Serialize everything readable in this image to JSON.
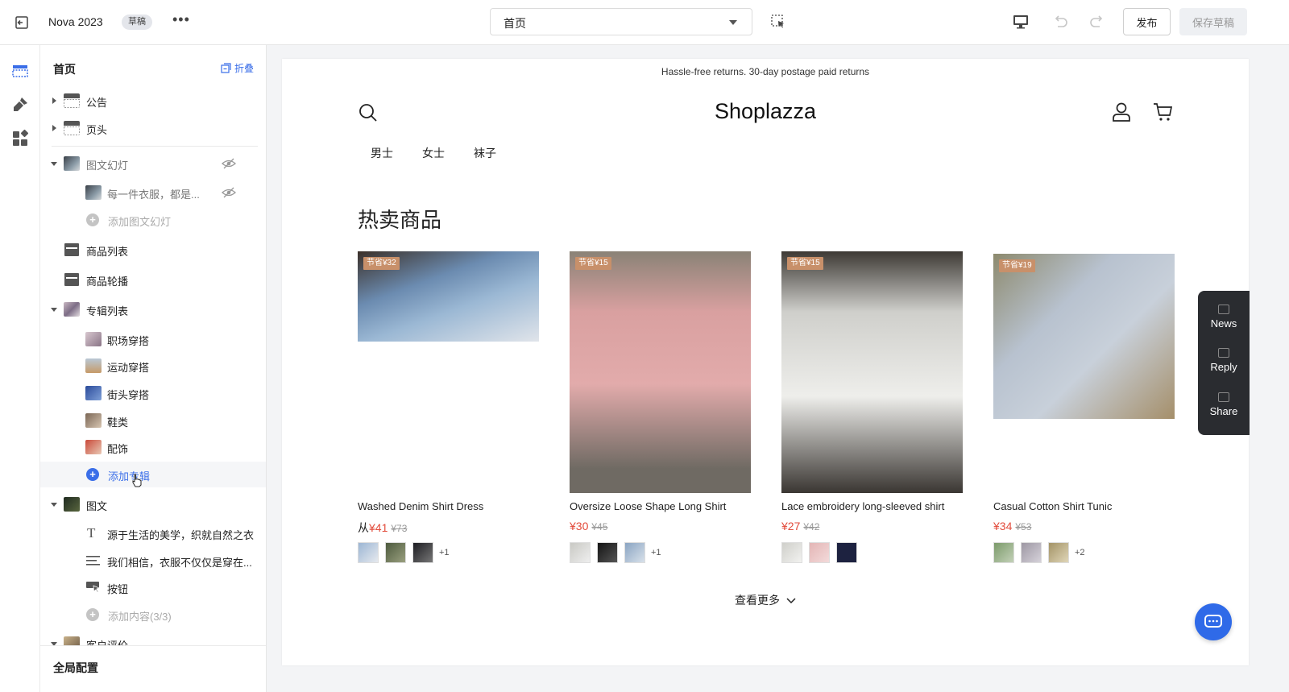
{
  "topbar": {
    "theme_name": "Nova 2023",
    "draft_badge": "草稿",
    "more_label": "•••",
    "page_select_value": "首页",
    "publish_label": "发布",
    "save_draft_label": "保存草稿"
  },
  "sidebar": {
    "title": "首页",
    "collapse_label": "折叠",
    "items": [
      {
        "label": "公告"
      },
      {
        "label": "页头"
      },
      {
        "label": "图文幻灯"
      },
      {
        "label": "每一件衣服，都是..."
      },
      {
        "label": "添加图文幻灯"
      },
      {
        "label": "商品列表"
      },
      {
        "label": "商品轮播"
      },
      {
        "label": "专辑列表"
      },
      {
        "label": "职场穿搭"
      },
      {
        "label": "运动穿搭"
      },
      {
        "label": "街头穿搭"
      },
      {
        "label": "鞋类"
      },
      {
        "label": "配饰"
      },
      {
        "label": "添加专辑"
      },
      {
        "label": "图文"
      },
      {
        "label": "源于生活的美学，织就自然之衣"
      },
      {
        "label": "我们相信，衣服不仅仅是穿在..."
      },
      {
        "label": "按钮"
      },
      {
        "label": "添加内容(3/3)"
      },
      {
        "label": "客户评价"
      }
    ],
    "footer_label": "全局配置"
  },
  "store": {
    "announcement": "Hassle-free returns. 30-day postage paid returns",
    "logo": "Shoplazza",
    "nav": [
      "男士",
      "女士",
      "袜子"
    ],
    "section_title": "热卖商品",
    "view_more": "查看更多",
    "products": [
      {
        "tag": "节省¥32",
        "name": "Washed Denim Shirt Dress",
        "from": "从",
        "price": "¥41",
        "original": "¥73",
        "more": "+1"
      },
      {
        "tag": "节省¥15",
        "name": "Oversize Loose Shape Long Shirt",
        "from": "",
        "price": "¥30",
        "original": "¥45",
        "more": "+1"
      },
      {
        "tag": "节省¥15",
        "name": "Lace embroidery long-sleeved shirt",
        "from": "",
        "price": "¥27",
        "original": "¥42",
        "more": ""
      },
      {
        "tag": "节省¥19",
        "name": "Casual Cotton Shirt Tunic",
        "from": "",
        "price": "¥34",
        "original": "¥53",
        "more": "+2"
      }
    ]
  },
  "float_panel": {
    "news": "News",
    "reply": "Reply",
    "share": "Share"
  },
  "colors": {
    "accent_blue": "#3a6ee8",
    "sale_red": "#e24b3b",
    "tag_bg": "#c8906a",
    "float_panel_bg": "#2a2c30"
  }
}
